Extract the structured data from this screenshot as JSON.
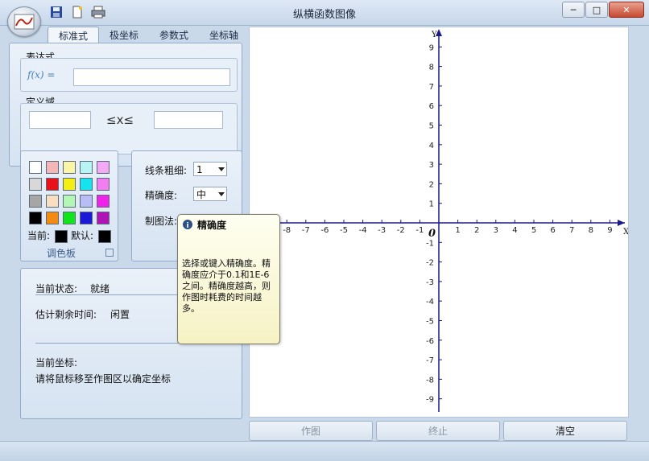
{
  "window": {
    "title": "纵横函数图像"
  },
  "tabs": [
    "标准式",
    "极坐标",
    "参数式",
    "坐标轴"
  ],
  "expression": {
    "group_label": "表达式",
    "fx_label": "f(x) =",
    "value": ""
  },
  "domain": {
    "group_label": "定义域",
    "lower": "",
    "upper": "",
    "relation": "≤x≤"
  },
  "palette": {
    "group_label": "调色板",
    "colors": [
      "#ffffff",
      "#f4b6b6",
      "#fbf5a6",
      "#b9f4f4",
      "#f3a9f3",
      "#d8d8d8",
      "#e8121b",
      "#f3ef12",
      "#16e3ee",
      "#f27df0",
      "#a6a6a6",
      "#f9dfc2",
      "#b4f7b4",
      "#b8bdf5",
      "#f123ea",
      "#000000",
      "#f38b12",
      "#11e41b",
      "#1a1ad6",
      "#b114b6"
    ],
    "current_label": "当前:",
    "default_label": "默认:",
    "current_color": "#000000",
    "default_color": "#000000"
  },
  "settings": {
    "line_width_label": "线条粗细:",
    "line_width_value": "1",
    "precision_label": "精确度:",
    "precision_value": "中",
    "method_label": "制图法:"
  },
  "status": {
    "state_label": "当前状态:",
    "state_value": "就绪",
    "remaining_label": "估计剩余时间:",
    "remaining_value": "闲置",
    "coord_label": "当前坐标:",
    "coord_hint": "请将鼠标移至作图区以确定坐标"
  },
  "tooltip": {
    "title": "精确度",
    "body": "选择或键入精确度。精确度应介于0.1和1E-6之间。精确度越高，则作图时耗费的时间越多。"
  },
  "axes": {
    "x_label": "X",
    "y_label": "Y",
    "origin_label": "0",
    "x_ticks": [
      "-8",
      "-7",
      "-6",
      "-5",
      "-4",
      "-3",
      "-2",
      "-1",
      "1",
      "2",
      "3",
      "4",
      "5",
      "6",
      "7",
      "8",
      "9"
    ],
    "y_ticks": [
      "9",
      "8",
      "7",
      "6",
      "5",
      "4",
      "3",
      "2",
      "1",
      "-1",
      "-2",
      "-3",
      "-4",
      "-5",
      "-6",
      "-7",
      "-8",
      "-9"
    ],
    "color": "#1a1a8c"
  },
  "buttons": {
    "draw": "作图",
    "stop": "终止",
    "clear": "清空"
  }
}
